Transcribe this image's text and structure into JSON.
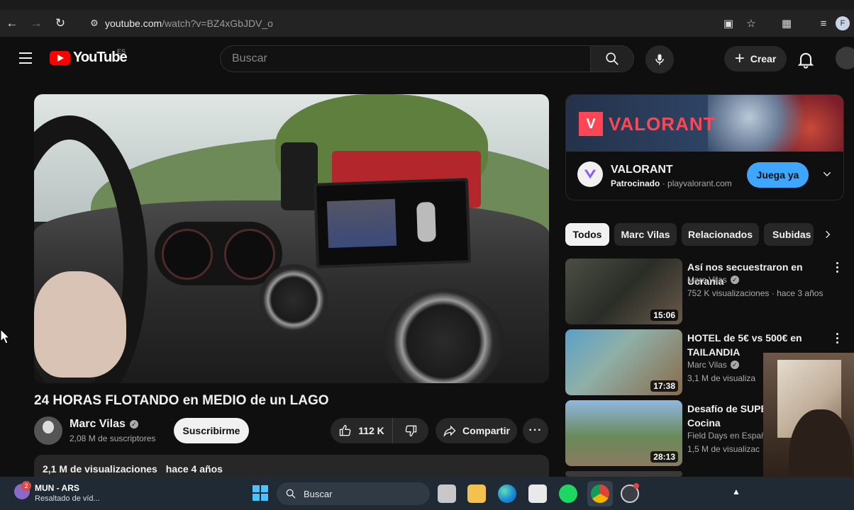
{
  "browser": {
    "url_host": "youtube.com",
    "url_path": "/watch?v=BZ4xGbJDV_o",
    "profile_initial": "F"
  },
  "header": {
    "logo_text": "YouTube",
    "country_code": "ES",
    "search_placeholder": "Buscar",
    "create_label": "Crear"
  },
  "video": {
    "title": "24 HORAS FLOTANDO en MEDIO de un LAGO",
    "channel": "Marc Vilas",
    "subscribers": "2,08 M de suscriptores",
    "subscribe_label": "Suscribirme",
    "likes": "112 K",
    "share_label": "Compartir",
    "views": "2,1 M de visualizaciones",
    "age": "hace 4 años"
  },
  "ad": {
    "banner_text": "VALORANT",
    "name": "VALORANT",
    "sponsored": "Patrocinado",
    "domain": " · playvalorant.com",
    "cta": "Juega ya"
  },
  "chips": [
    "Todos",
    "Marc Vilas",
    "Relacionados",
    "Subidas"
  ],
  "recommendations": [
    {
      "title": "Así nos secuestraron en Ucrania",
      "channel": "Marc Vilas",
      "meta": "752 K visualizaciones · hace 3 años",
      "duration": "15:06"
    },
    {
      "title": "HOTEL de 5€ vs 500€ en TAILANDIA",
      "channel": "Marc Vilas",
      "meta": "3,1 M de visualiza",
      "duration": "17:38"
    },
    {
      "title": "Desafío de SUPER Cazando y Cocina",
      "channel": "Field Days en Españ",
      "meta": "1,5 M de visualizac",
      "duration": "28:13"
    }
  ],
  "taskbar": {
    "notif_count": "2",
    "widget_line1": "MUN - ARS",
    "widget_line2": "Resaltado de víd...",
    "search_label": "Buscar"
  }
}
